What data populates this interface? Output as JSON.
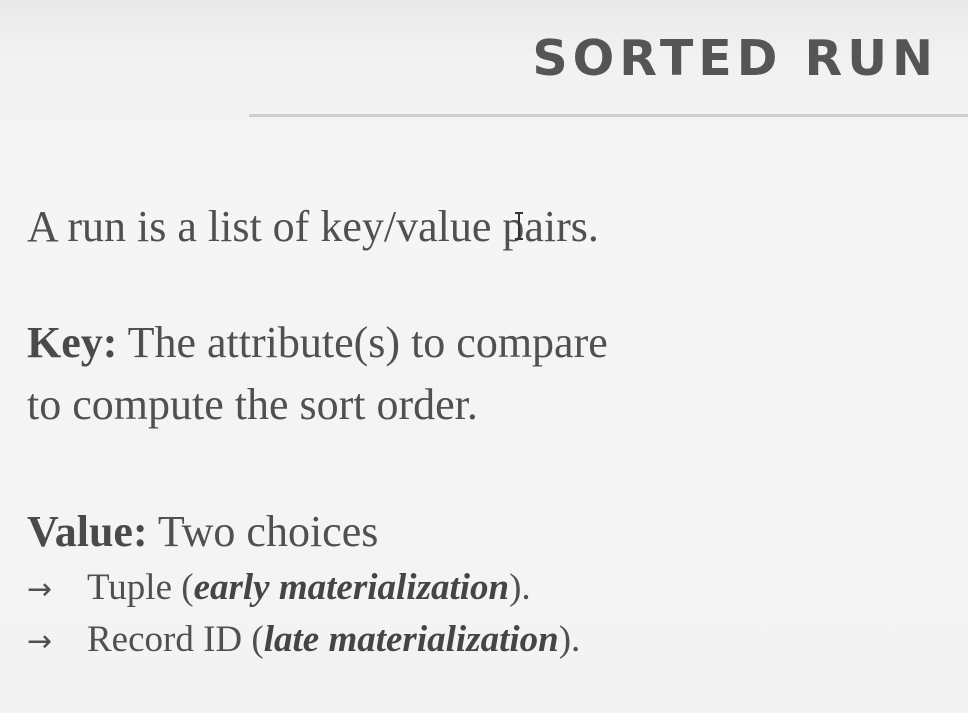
{
  "slide": {
    "title": "SORTED RUN",
    "intro": "A run is a list of key/value pairs.",
    "key": {
      "label": "Key:",
      "text_line1": "The attribute(s) to compare",
      "text_line2": "to compute the sort order."
    },
    "value": {
      "label": "Value:",
      "text": "Two choices",
      "choices": [
        {
          "arrow": "→",
          "prefix": "Tuple (",
          "emphasis": "early materialization",
          "suffix": ")."
        },
        {
          "arrow": "→",
          "prefix": "Record ID (",
          "emphasis": "late materialization",
          "suffix": ")."
        }
      ]
    }
  },
  "colors": {
    "text": "#505050",
    "title": "#555555",
    "rule": "#cfcfcf",
    "background": "#f3f3f3"
  },
  "icons": {
    "cursor": "text-cursor-icon"
  }
}
